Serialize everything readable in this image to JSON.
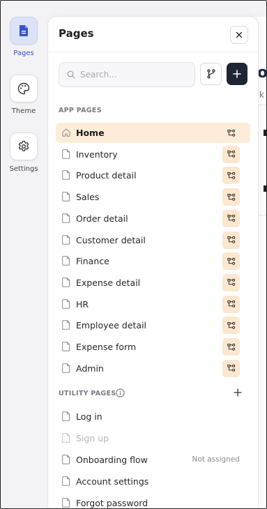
{
  "rail": {
    "items": [
      {
        "label": "Pages",
        "icon": "document-icon",
        "active": true
      },
      {
        "label": "Theme",
        "icon": "palette-icon",
        "active": false
      },
      {
        "label": "Settings",
        "icon": "gear-icon",
        "active": false
      }
    ]
  },
  "panel": {
    "title": "Pages",
    "search_placeholder": "Search...",
    "app_pages_heading": "APP PAGES",
    "utility_pages_heading": "UTILITY PAGES",
    "app_pages": [
      {
        "label": "Home",
        "active": true
      },
      {
        "label": "Inventory"
      },
      {
        "label": "Product detail"
      },
      {
        "label": "Sales"
      },
      {
        "label": "Order detail"
      },
      {
        "label": "Customer detail"
      },
      {
        "label": "Finance"
      },
      {
        "label": "Expense detail"
      },
      {
        "label": "HR"
      },
      {
        "label": "Employee detail"
      },
      {
        "label": "Expense form"
      },
      {
        "label": "Admin"
      }
    ],
    "utility_pages": [
      {
        "label": "Log in"
      },
      {
        "label": "Sign up",
        "disabled": true
      },
      {
        "label": "Onboarding flow",
        "status": "Not assigned"
      },
      {
        "label": "Account settings"
      },
      {
        "label": "Forgot password"
      }
    ]
  },
  "colors": {
    "accent_blue": "#3a52c8",
    "active_row": "#fdecd8",
    "flow_tag": "#fce7cf",
    "add_button": "#1f2533"
  }
}
